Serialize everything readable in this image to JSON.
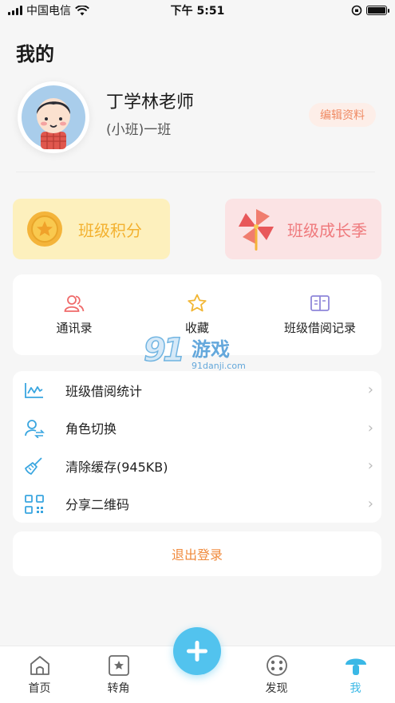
{
  "status_bar": {
    "carrier": "中国电信",
    "time": "下午 5:51"
  },
  "page": {
    "title": "我的"
  },
  "profile": {
    "name": "丁学林老师",
    "class_name": "(小班)一班",
    "edit_label": "编辑资料"
  },
  "cards": {
    "points_label": "班级积分",
    "season_label": "班级成长季"
  },
  "quick_actions": [
    {
      "label": "通讯录",
      "icon": "contacts-icon"
    },
    {
      "label": "收藏",
      "icon": "star-icon"
    },
    {
      "label": "班级借阅记录",
      "icon": "book-icon"
    }
  ],
  "menu": [
    {
      "label": "班级借阅统计",
      "icon": "chart-icon"
    },
    {
      "label": "角色切换",
      "icon": "switch-user-icon"
    },
    {
      "label": "清除缓存(945KB)",
      "icon": "broom-icon"
    },
    {
      "label": "分享二维码",
      "icon": "qrcode-icon"
    }
  ],
  "logout_label": "退出登录",
  "watermark": {
    "brand": "游戏",
    "url": "91danji.com"
  },
  "tabbar": {
    "items": [
      {
        "label": "首页",
        "icon": "home-icon"
      },
      {
        "label": "转角",
        "icon": "card-icon"
      },
      {
        "label": "发现",
        "icon": "discover-icon"
      },
      {
        "label": "我",
        "icon": "mushroom-icon"
      }
    ],
    "active_index": 3
  },
  "colors": {
    "accent": "#52c3ee",
    "points": "#f3b12f",
    "season": "#ef7a7d",
    "logout": "#f08a3c"
  }
}
